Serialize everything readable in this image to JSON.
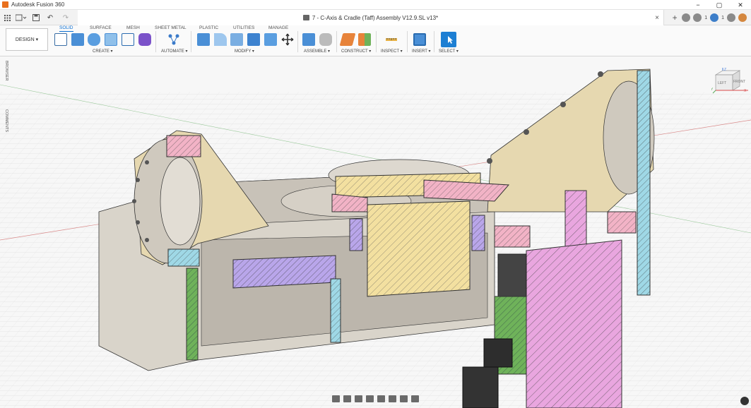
{
  "app": {
    "title": "Autodesk Fusion 360"
  },
  "window_controls": {
    "minimize": "−",
    "maximize": "▢",
    "close": "✕"
  },
  "quick_access": {
    "undo": "↶",
    "redo": "↷"
  },
  "document": {
    "tab_title": "7 - C-Axis & Cradle (Taff) Assembly V12.9.SL v13*",
    "close": "×"
  },
  "header_right": {
    "add": "+",
    "job_count": "1",
    "notification_count": "1"
  },
  "ribbon": {
    "workspace_button": "DESIGN ▾",
    "tabs": [
      {
        "label": "SOLID",
        "active": true
      },
      {
        "label": "SURFACE",
        "active": false
      },
      {
        "label": "MESH",
        "active": false
      },
      {
        "label": "SHEET METAL",
        "active": false
      },
      {
        "label": "PLASTIC",
        "active": false
      },
      {
        "label": "UTILITIES",
        "active": false
      },
      {
        "label": "MANAGE",
        "active": false
      }
    ],
    "groups": [
      {
        "label": "CREATE ▾"
      },
      {
        "label": "AUTOMATE ▾"
      },
      {
        "label": "MODIFY ▾"
      },
      {
        "label": "ASSEMBLE ▾"
      },
      {
        "label": "CONSTRUCT ▾"
      },
      {
        "label": "INSPECT ▾"
      },
      {
        "label": "INSERT ▾"
      },
      {
        "label": "SELECT ▾"
      }
    ]
  },
  "side_panels": {
    "browser": "BROWSER",
    "comments": "COMMENTS"
  },
  "viewcube": {
    "left": "LEFT",
    "front": "FRONT",
    "axis_x": "X",
    "axis_y": "Y",
    "axis_z": "Z"
  },
  "colors": {
    "accent": "#0a6ed1",
    "model_tan": "#e6d8b0",
    "model_grey": "#d0ccc4",
    "hatch_pink": "#f2b3c6",
    "hatch_cyan": "#9fd8e6",
    "hatch_purple": "#b9a6ea",
    "hatch_yellow": "#f3e0a0",
    "hatch_magenta": "#e9a6df",
    "hatch_green": "#6fb25a"
  }
}
